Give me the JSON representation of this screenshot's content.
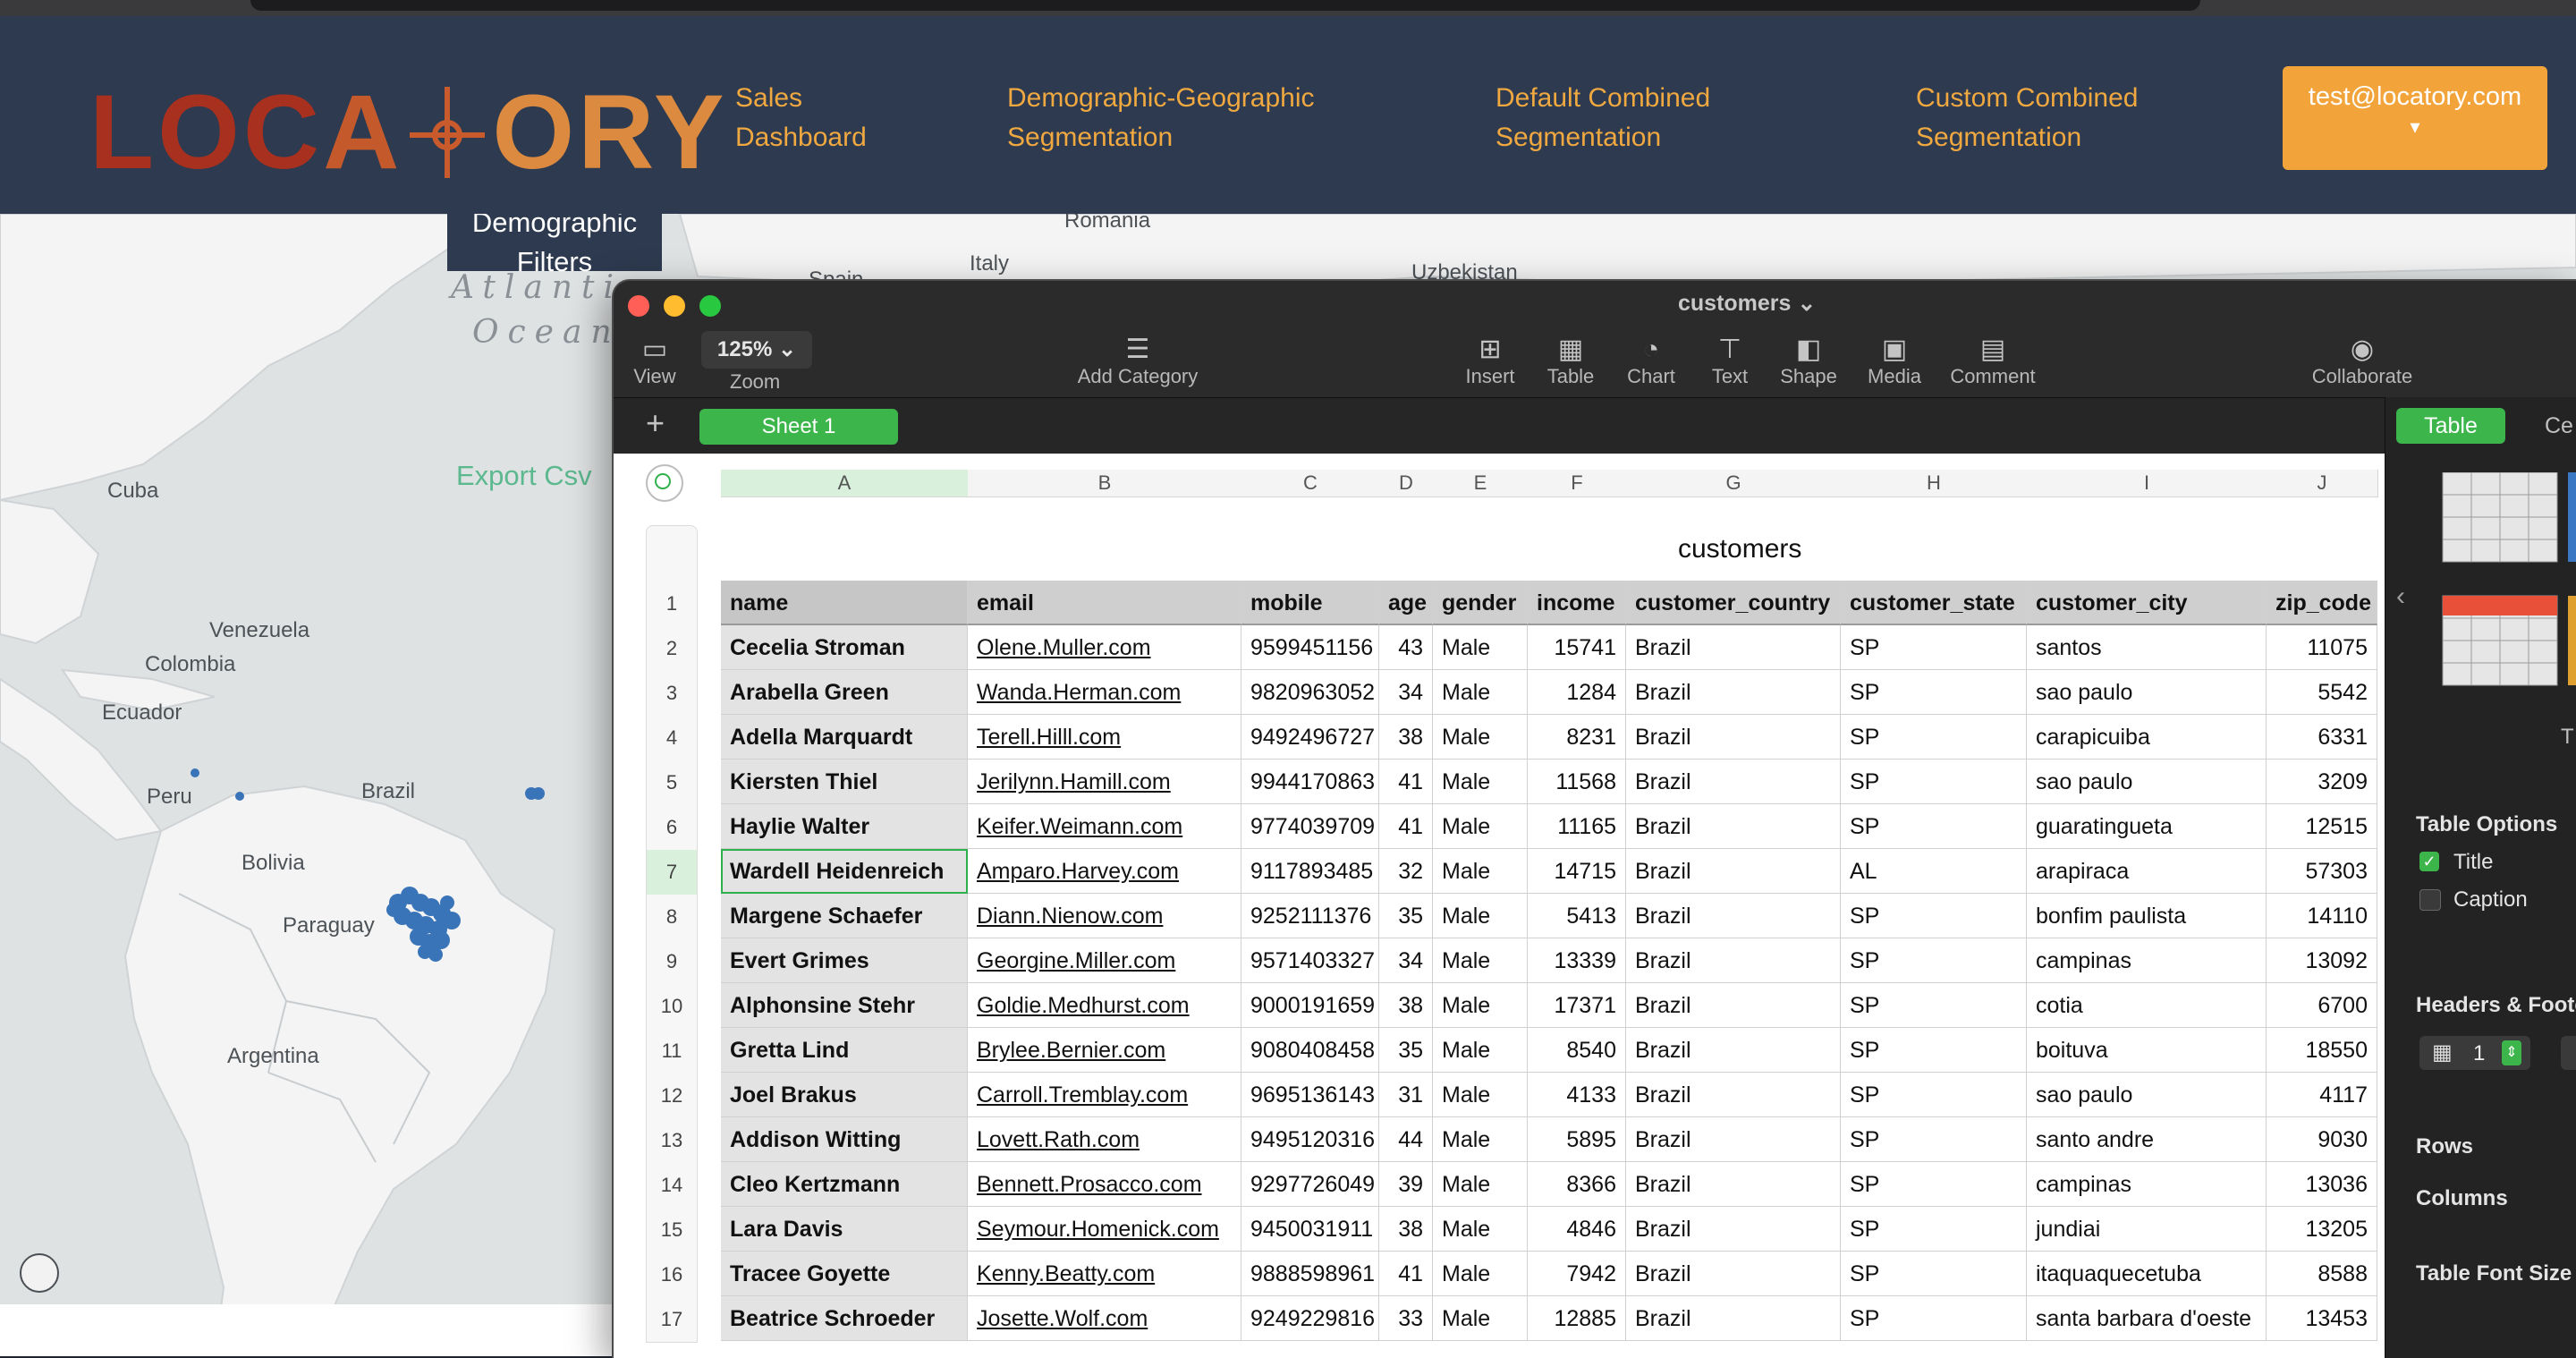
{
  "site": {
    "logo_text": "LOCATORY",
    "nav": [
      {
        "label": "Sales\nDashboard"
      },
      {
        "label": "Demographic-Geographic\nSegmentation"
      },
      {
        "label": "Default Combined\nSegmentation"
      },
      {
        "label": "Custom Combined\nSegmentation"
      }
    ],
    "user_email": "test@locatory.com",
    "user_caret": "▾",
    "colors": {
      "nav_bg": "#2d3a4f",
      "nav_link": "#f0a840",
      "user_button": "#f2a43a",
      "export": "#5cb88e"
    }
  },
  "map": {
    "filters_button": "Demographic\nFilters",
    "export_label": "Export Csv",
    "labels": {
      "romania": "Romania",
      "italy": "Italy",
      "spain": "Spain",
      "uzbekistan": "Uzbekistan",
      "ocean_1": "Atlantic",
      "ocean_2": "Ocean",
      "cuba": "Cuba",
      "venezuela": "Venezuela",
      "colombia": "Colombia",
      "ecuador": "Ecuador",
      "peru": "Peru",
      "brazil": "Brazil",
      "bolivia": "Bolivia",
      "paraguay": "Paraguay",
      "argentina": "Argentina"
    },
    "marker_color": "#3a74b8"
  },
  "numbers": {
    "window_title": "customers",
    "toolbar": {
      "view": "View",
      "zoom_value": "125%",
      "zoom": "Zoom",
      "add_category": "Add Category",
      "insert": "Insert",
      "table": "Table",
      "chart": "Chart",
      "text": "Text",
      "shape": "Shape",
      "media": "Media",
      "comment": "Comment",
      "collaborate": "Collaborate"
    },
    "sheet_add": "+",
    "sheet_tab": "Sheet 1",
    "sidebar": {
      "tab_table": "Table",
      "tab_cell": "Ce",
      "table_options": "Table Options",
      "title_label": "Title",
      "title_checked": true,
      "caption_label": "Caption",
      "caption_checked": false,
      "headers_footers": "Headers & Foote",
      "header_rows_value": "1",
      "rows": "Rows",
      "columns": "Columns",
      "font_size": "Table Font Size",
      "style_caption": "T"
    },
    "table_title": "customers",
    "column_letters": [
      "A",
      "B",
      "C",
      "D",
      "E",
      "F",
      "G",
      "H",
      "I",
      "J"
    ],
    "row_numbers": [
      "1",
      "2",
      "3",
      "4",
      "5",
      "6",
      "7",
      "8",
      "9",
      "10",
      "11",
      "12",
      "13",
      "14",
      "15",
      "16",
      "17"
    ],
    "selected_row": "7",
    "selected_column": "A",
    "headers": [
      "name",
      "email",
      "mobile",
      "age",
      "gender",
      "income",
      "customer_country",
      "customer_state",
      "customer_city",
      "zip_code"
    ],
    "rows": [
      [
        "Cecelia Stroman",
        "Olene.Muller.com",
        "9599451156",
        "43",
        "Male",
        "15741",
        "Brazil",
        "SP",
        "santos",
        "11075"
      ],
      [
        "Arabella Green",
        "Wanda.Herman.com",
        "9820963052",
        "34",
        "Male",
        "1284",
        "Brazil",
        "SP",
        "sao paulo",
        "5542"
      ],
      [
        "Adella Marquardt",
        "Terell.Hilll.com",
        "9492496727",
        "38",
        "Male",
        "8231",
        "Brazil",
        "SP",
        "carapicuiba",
        "6331"
      ],
      [
        "Kiersten Thiel",
        "Jerilynn.Hamill.com",
        "9944170863",
        "41",
        "Male",
        "11568",
        "Brazil",
        "SP",
        "sao paulo",
        "3209"
      ],
      [
        "Haylie Walter",
        "Keifer.Weimann.com",
        "9774039709",
        "41",
        "Male",
        "11165",
        "Brazil",
        "SP",
        "guaratingueta",
        "12515"
      ],
      [
        "Wardell Heidenreich",
        "Amparo.Harvey.com",
        "9117893485",
        "32",
        "Male",
        "14715",
        "Brazil",
        "AL",
        "arapiraca",
        "57303"
      ],
      [
        "Margene Schaefer",
        "Diann.Nienow.com",
        "9252111376",
        "35",
        "Male",
        "5413",
        "Brazil",
        "SP",
        "bonfim paulista",
        "14110"
      ],
      [
        "Evert Grimes",
        "Georgine.Miller.com",
        "9571403327",
        "34",
        "Male",
        "13339",
        "Brazil",
        "SP",
        "campinas",
        "13092"
      ],
      [
        "Alphonsine Stehr",
        "Goldie.Medhurst.com",
        "9000191659",
        "38",
        "Male",
        "17371",
        "Brazil",
        "SP",
        "cotia",
        "6700"
      ],
      [
        "Gretta Lind",
        "Brylee.Bernier.com",
        "9080408458",
        "35",
        "Male",
        "8540",
        "Brazil",
        "SP",
        "boituva",
        "18550"
      ],
      [
        "Joel Brakus",
        "Carroll.Tremblay.com",
        "9695136143",
        "31",
        "Male",
        "4133",
        "Brazil",
        "SP",
        "sao paulo",
        "4117"
      ],
      [
        "Addison Witting",
        "Lovett.Rath.com",
        "9495120316",
        "44",
        "Male",
        "5895",
        "Brazil",
        "SP",
        "santo andre",
        "9030"
      ],
      [
        "Cleo Kertzmann",
        "Bennett.Prosacco.com",
        "9297726049",
        "39",
        "Male",
        "8366",
        "Brazil",
        "SP",
        "campinas",
        "13036"
      ],
      [
        "Lara Davis",
        "Seymour.Homenick.com",
        "9450031911",
        "38",
        "Male",
        "4846",
        "Brazil",
        "SP",
        "jundiai",
        "13205"
      ],
      [
        "Tracee Goyette",
        "Kenny.Beatty.com",
        "9888598961",
        "41",
        "Male",
        "7942",
        "Brazil",
        "SP",
        "itaquaquecetuba",
        "8588"
      ],
      [
        "Beatrice Schroeder",
        "Josette.Wolf.com",
        "9249229816",
        "33",
        "Male",
        "12885",
        "Brazil",
        "SP",
        "santa barbara d'oeste",
        "13453"
      ]
    ]
  }
}
